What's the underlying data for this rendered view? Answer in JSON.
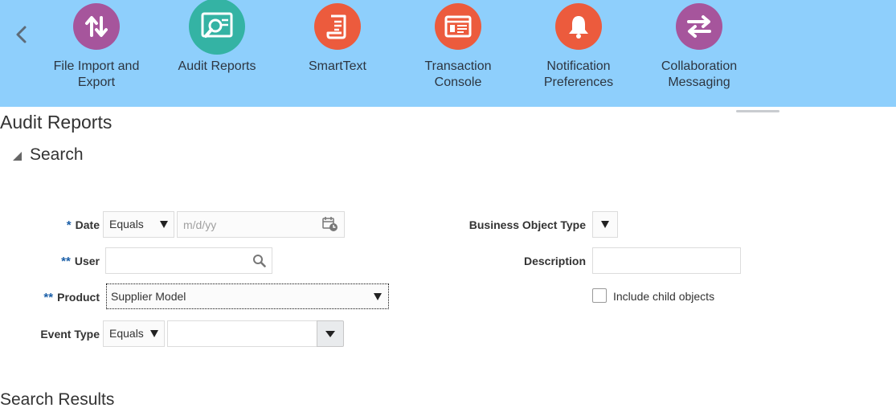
{
  "springboard": {
    "items": [
      {
        "label": "File Import and\nExport",
        "icon": "arrows-up-down-icon",
        "color": "#a6559c"
      },
      {
        "label": "Audit Reports",
        "icon": "audit-report-icon",
        "color": "#34b3a4"
      },
      {
        "label": "SmartText",
        "icon": "document-scroll-icon",
        "color": "#ec5b3d"
      },
      {
        "label": "Transaction\nConsole",
        "icon": "console-window-icon",
        "color": "#ec5b3d"
      },
      {
        "label": "Notification\nPreferences",
        "icon": "bell-icon",
        "color": "#ec5b3d"
      },
      {
        "label": "Collaboration\nMessaging",
        "icon": "arrows-swap-icon",
        "color": "#a6559c"
      }
    ],
    "background": "#8ecffc"
  },
  "page": {
    "title": "Audit Reports",
    "search_title": "Search",
    "results_title": "Search Results"
  },
  "form": {
    "date": {
      "required_marker": "*",
      "label": "Date",
      "operator": "Equals",
      "placeholder": "m/d/yy"
    },
    "user": {
      "required_marker": "**",
      "label": "User",
      "value": ""
    },
    "product": {
      "required_marker": "**",
      "label": "Product",
      "value": "Supplier Model"
    },
    "event_type": {
      "label": "Event Type",
      "operator": "Equals",
      "value": ""
    },
    "business_object_type": {
      "label": "Business Object Type",
      "value": ""
    },
    "description": {
      "label": "Description",
      "value": ""
    },
    "include_child": {
      "label": "Include child objects",
      "checked": false
    }
  }
}
